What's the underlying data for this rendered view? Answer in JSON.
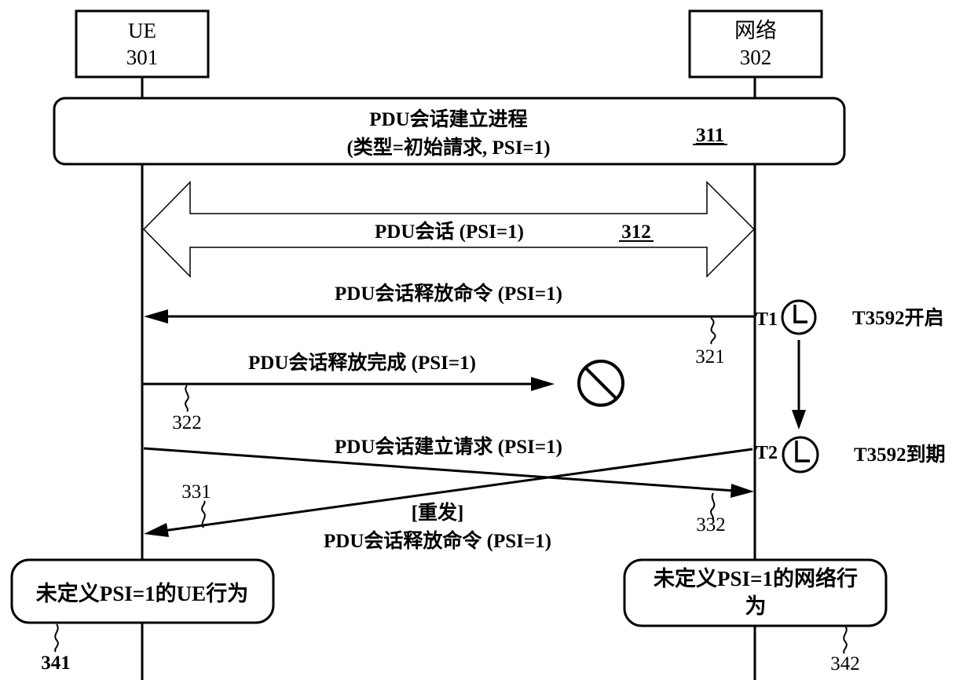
{
  "entities": {
    "ue": {
      "name": "UE",
      "id": "301"
    },
    "network": {
      "name": "网络",
      "id": "302"
    }
  },
  "procedure_311": {
    "title": "PDU会话建立进程",
    "subtitle": "(类型=初始請求, PSI=1)",
    "ref": "311"
  },
  "session_312": {
    "label": "PDU会话 (PSI=1)",
    "ref": "312"
  },
  "messages": {
    "m321": {
      "label": "PDU会话释放命令 (PSI=1)",
      "ref": "321",
      "direction": "network-to-ue"
    },
    "m322": {
      "label": "PDU会话释放完成 (PSI=1)",
      "ref": "322",
      "direction": "ue-to-blocked"
    },
    "m332": {
      "label": "PDU会话建立请求 (PSI=1)",
      "ref": "332",
      "direction": "ue-to-network"
    },
    "m331": {
      "label_line1": "[重发]",
      "label_line2": "PDU会话释放命令 (PSI=1)",
      "ref": "331",
      "direction": "network-to-ue"
    }
  },
  "timer": {
    "t1_label": "T1",
    "t2_label": "T2",
    "start_text": "T3592开启",
    "expire_text": "T3592到期"
  },
  "outcomes": {
    "ue": {
      "text": "未定义PSI=1的UE行为",
      "ref": "341"
    },
    "network": {
      "line1": "未定义PSI=1的网络行",
      "line2": "为",
      "ref": "342"
    }
  }
}
